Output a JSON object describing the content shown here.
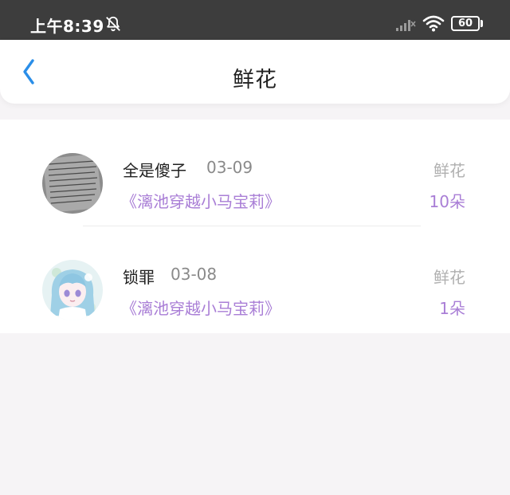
{
  "status_bar": {
    "time": "上午8:39",
    "battery": "60"
  },
  "header": {
    "title": "鲜花"
  },
  "items": [
    {
      "user": "全是傻子",
      "date": "03-09",
      "book": "《漓池穿越小马宝莉》",
      "gift": "鲜花",
      "count": "10朵"
    },
    {
      "user": "锁罪",
      "date": "03-08",
      "book": "《漓池穿越小马宝莉》",
      "gift": "鲜花",
      "count": "1朵"
    }
  ],
  "icons": {
    "back": "chevron-left-icon",
    "bell": "bell-off-icon",
    "signal": "signal-icon",
    "wifi": "wifi-icon"
  },
  "colors": {
    "accent_purple": "#a97ed6",
    "back_blue": "#2a8ee8",
    "status_bar": "#3d3d3d"
  }
}
